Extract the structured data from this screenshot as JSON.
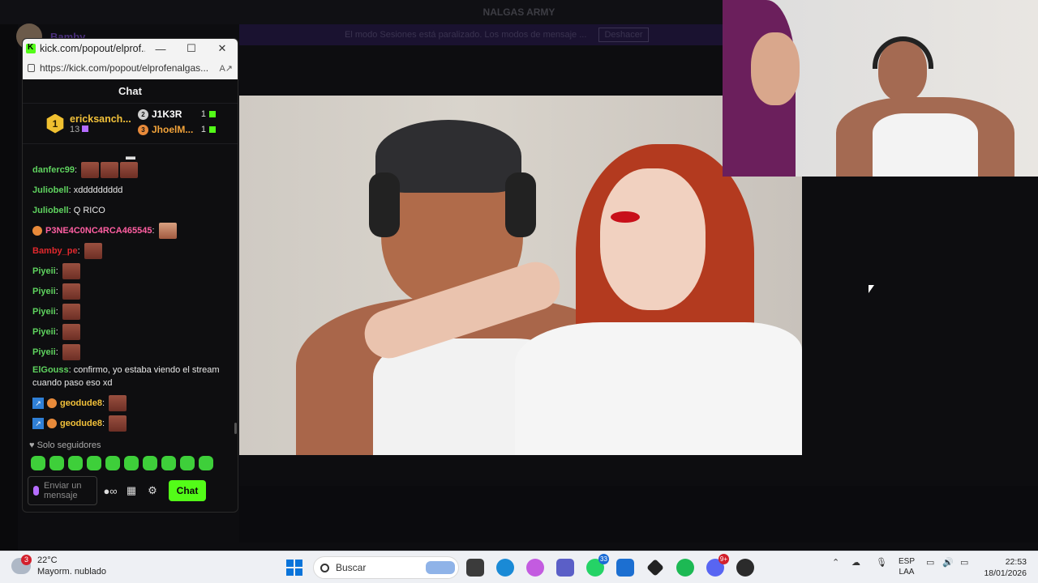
{
  "background_app": {
    "server_title": "NALGAS ARMY",
    "username": "Bamby",
    "banner_text": "El modo Sesiones está paralizado. Los modos de mensaje ...",
    "banner_button": "Deshacer"
  },
  "popout": {
    "window_title": "kick.com/popout/elprof...",
    "url": "https://kick.com/popout/elprofenalgas...",
    "minimize": "—",
    "maximize": "☐",
    "close": "✕",
    "chat_header": "Chat",
    "leaderboard": {
      "first": {
        "rank": "1",
        "name": "ericksanch...",
        "count": "13"
      },
      "others": [
        {
          "rank": "2",
          "name": "J1K3R",
          "count": "1",
          "color": "#ffffff",
          "rank_color": "#cfcfcf"
        },
        {
          "rank": "3",
          "name": "JhoelM...",
          "count": "1",
          "color": "#f2a33a",
          "rank_color": "#e88a3a"
        }
      ]
    },
    "messages": [
      {
        "user": "danferc99",
        "color": "#5fd35f",
        "text": "",
        "emotes": 3
      },
      {
        "user": "Juliobell",
        "color": "#5fd35f",
        "text": "xddddddddd",
        "emotes": 0
      },
      {
        "user": "Juliobell",
        "color": "#5fd35f",
        "text": "Q RICO",
        "emotes": 0
      },
      {
        "user": "P3NE4C0NC4RCA465545",
        "color": "#ff5fa2",
        "text": "",
        "emotes": 1,
        "peach": true
      },
      {
        "user": "Bamby_pe",
        "color": "#e0282d",
        "text": "",
        "emotes": 1
      },
      {
        "user": "Piyeii",
        "color": "#5fd35f",
        "text": "",
        "emotes": 1
      },
      {
        "user": "Piyeii",
        "color": "#5fd35f",
        "text": "",
        "emotes": 1
      },
      {
        "user": "Piyeii",
        "color": "#5fd35f",
        "text": "",
        "emotes": 1
      },
      {
        "user": "Piyeii",
        "color": "#5fd35f",
        "text": "",
        "emotes": 1
      },
      {
        "user": "Piyeii",
        "color": "#5fd35f",
        "text": "",
        "emotes": 1
      },
      {
        "user": "ElGouss",
        "color": "#5fd35f",
        "text": "confirmo, yo estaba viendo el stream cuando paso eso xd",
        "emotes": 0,
        "multi": true
      },
      {
        "user": "geodude8",
        "color": "#f2c13a",
        "text": "",
        "emotes": 1,
        "peach": true,
        "boost": true
      },
      {
        "user": "geodude8",
        "color": "#f2c13a",
        "text": "",
        "emotes": 1,
        "peach": true,
        "boost": true
      }
    ],
    "followers_only": "Solo seguidores",
    "input_placeholder": "Enviar un mensaje",
    "send_button": "Chat"
  },
  "taskbar": {
    "weather_badge": "3",
    "temperature": "22°C",
    "condition": "Mayorm. nublado",
    "search_placeholder": "Buscar",
    "whatsapp_badge": "33",
    "discord_badge": "9+",
    "lang_line1": "ESP",
    "lang_line2": "LAA",
    "time": "22:53",
    "date": "18/01/2026"
  }
}
